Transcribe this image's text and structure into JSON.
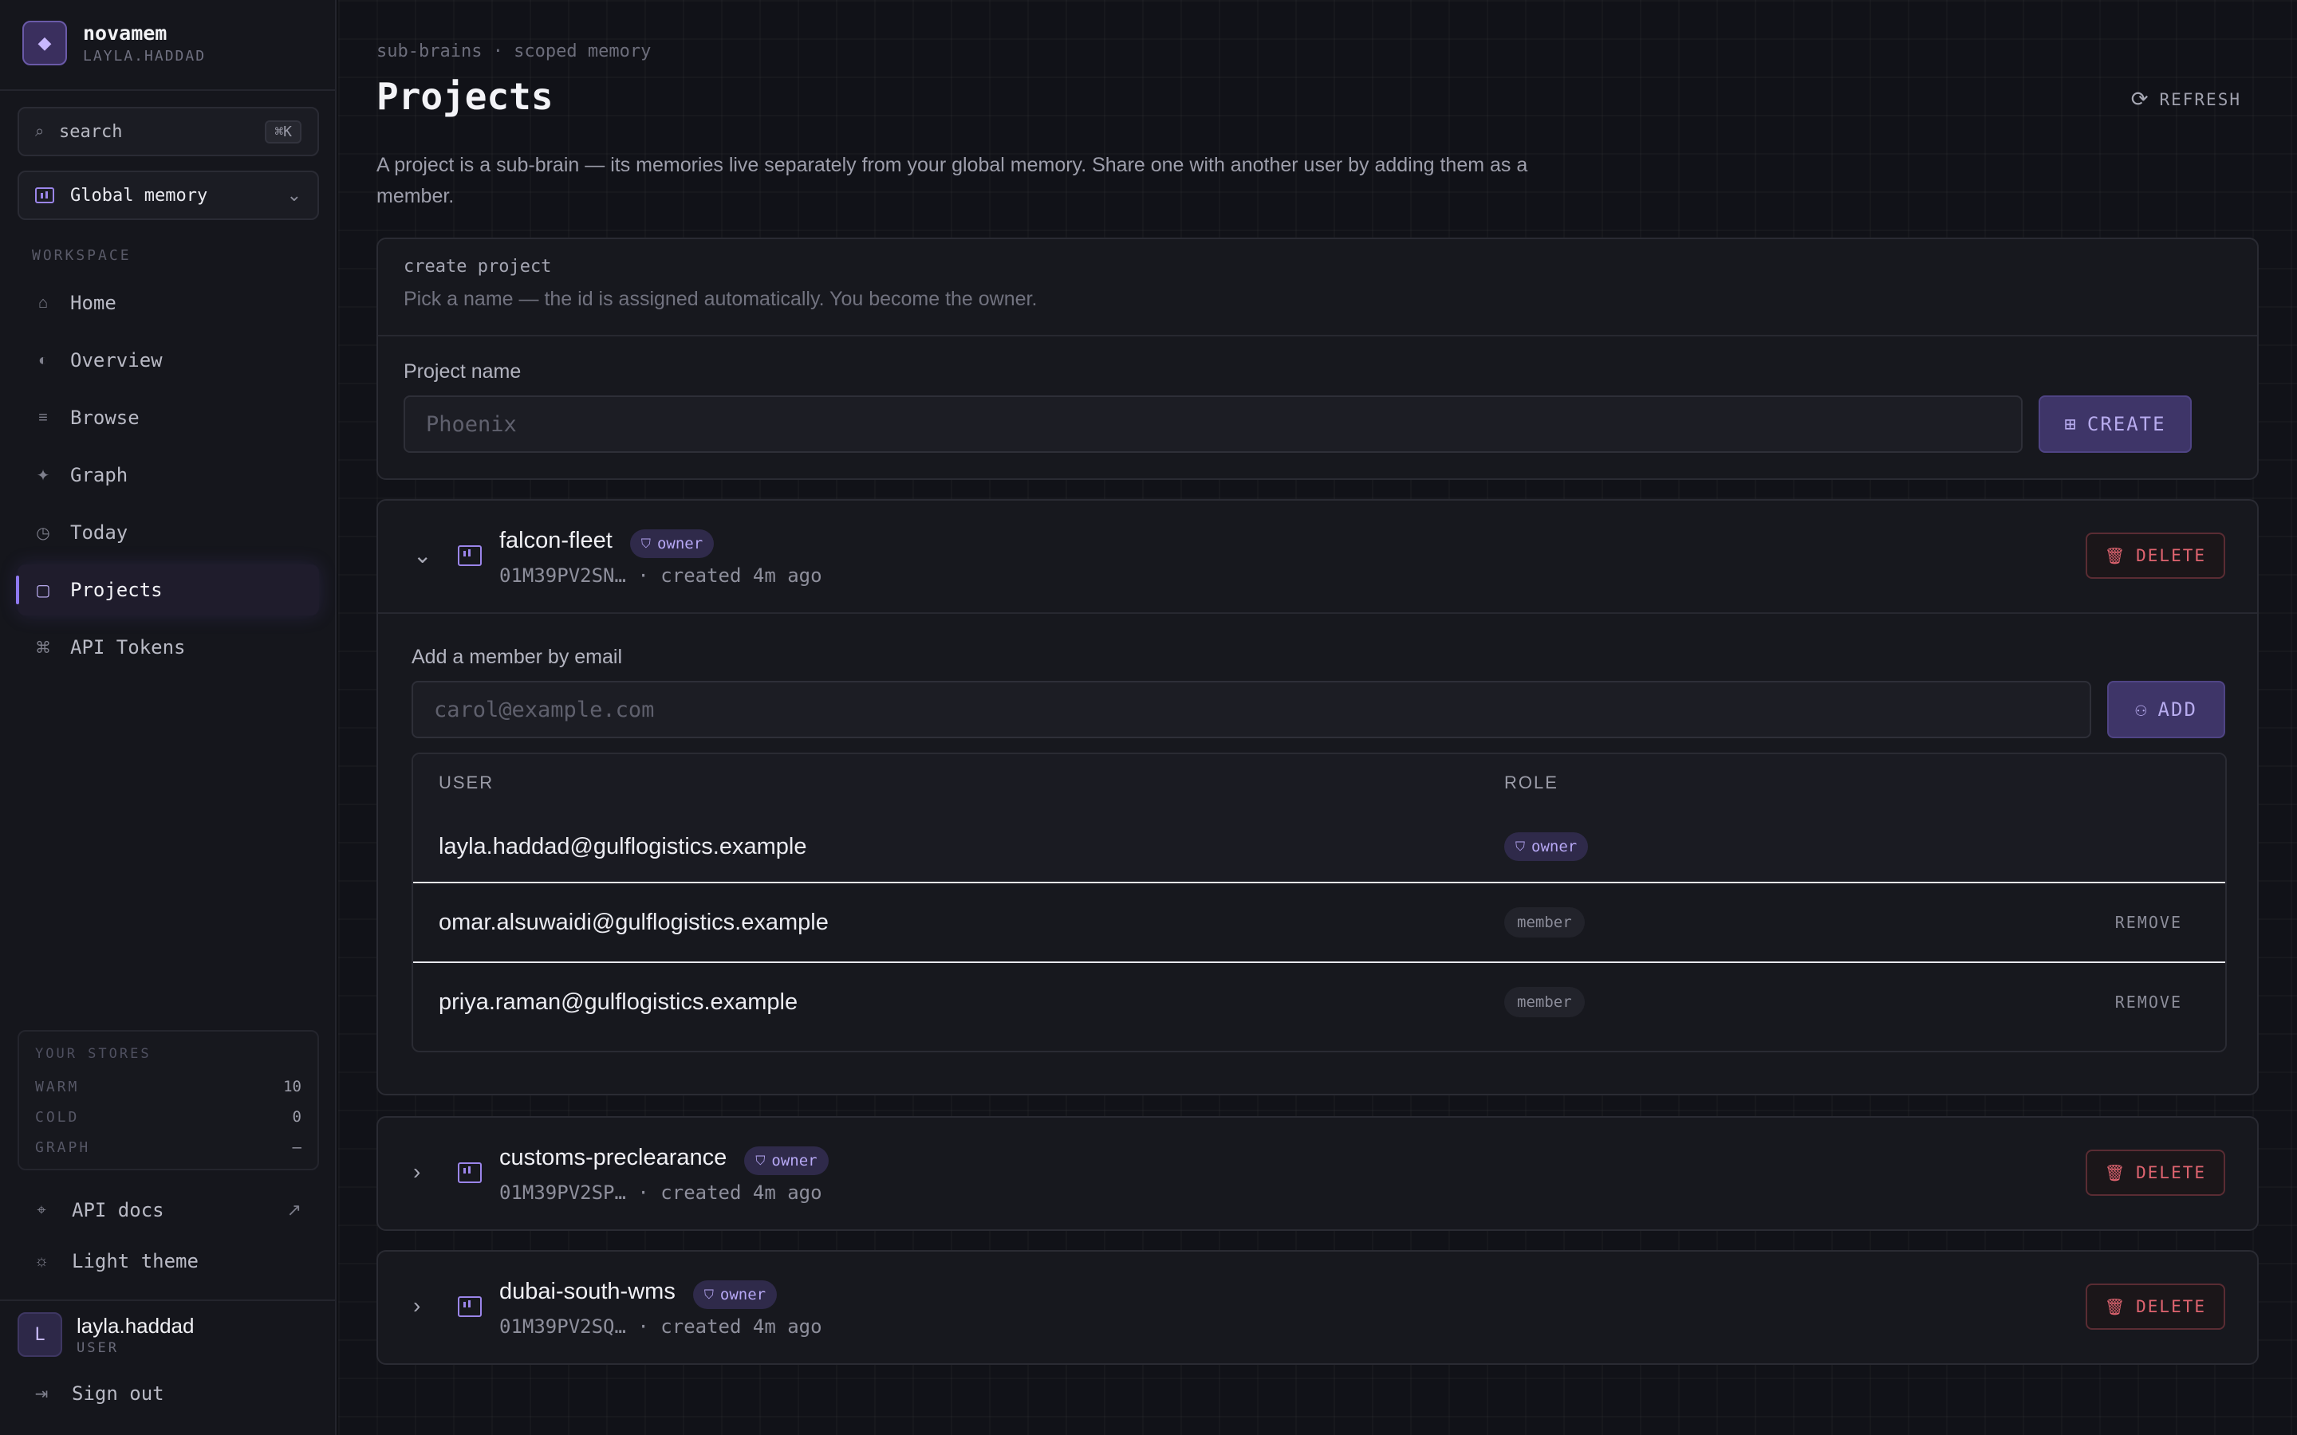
{
  "sidebar": {
    "brand": {
      "logo_glyph": "◆",
      "name": "novamem",
      "user": "LAYLA.HADDAD"
    },
    "search": {
      "placeholder": "search",
      "shortcut": "⌘K"
    },
    "scope": {
      "label": "Global memory"
    },
    "section_label": "WORKSPACE",
    "nav": [
      {
        "label": "Home",
        "icon": "⌂"
      },
      {
        "label": "Overview",
        "icon": "◐"
      },
      {
        "label": "Browse",
        "icon": "≡"
      },
      {
        "label": "Graph",
        "icon": "✦"
      },
      {
        "label": "Today",
        "icon": "◷"
      },
      {
        "label": "Projects",
        "icon": "▢"
      },
      {
        "label": "API Tokens",
        "icon": "⌘"
      }
    ],
    "stores": {
      "title": "YOUR STORES",
      "rows": [
        {
          "name": "WARM",
          "value": "10"
        },
        {
          "name": "COLD",
          "value": "0"
        },
        {
          "name": "GRAPH",
          "value": "—"
        }
      ]
    },
    "api_docs": "API docs",
    "theme_toggle": "Light theme",
    "user": {
      "initial": "L",
      "name": "layla.haddad",
      "role": "USER"
    },
    "sign_out": "Sign out"
  },
  "main": {
    "breadcrumb": "sub-brains · scoped memory",
    "title": "Projects",
    "refresh_label": "REFRESH",
    "intro": "A project is a sub-brain — its memories live separately from your global memory. Share one with another user by adding them as a member.",
    "create": {
      "title": "create project",
      "subtitle": "Pick a name — the id is assigned automatically. You become the owner.",
      "field_label": "Project name",
      "placeholder": "Phoenix",
      "button": "CREATE"
    },
    "projects": [
      {
        "name": "falcon-fleet",
        "badge": "owner",
        "meta": "01M39PV2SN… · created 4m ago",
        "delete": "DELETE",
        "add_member_label": "Add a member by email",
        "add_member_placeholder": "carol@example.com",
        "add_button": "ADD",
        "table": {
          "col_user": "USER",
          "col_role": "ROLE",
          "rows": [
            {
              "email": "layla.haddad@gulflogistics.example",
              "role": "owner"
            },
            {
              "email": "omar.alsuwaidi@gulflogistics.example",
              "role": "member",
              "action": "REMOVE"
            },
            {
              "email": "priya.raman@gulflogistics.example",
              "role": "member",
              "action": "REMOVE"
            }
          ]
        }
      },
      {
        "name": "customs-preclearance",
        "badge": "owner",
        "meta": "01M39PV2SP… · created 4m ago",
        "delete": "DELETE"
      },
      {
        "name": "dubai-south-wms",
        "badge": "owner",
        "meta": "01M39PV2SQ… · created 4m ago",
        "delete": "DELETE"
      }
    ]
  },
  "colors": {
    "accent": "#8f79f0",
    "danger": "#e06470",
    "background": "#111218",
    "sidebar": "#15161c"
  },
  "icons": {
    "brand": "diamond-icon",
    "search": "search-icon",
    "scope": "folder-chart-icon",
    "refresh": "refresh-icon",
    "expand": "chevron-icon",
    "delete": "trash-icon",
    "owner": "shield-icon",
    "external": "external-link-icon",
    "theme": "sun-icon",
    "signout": "sign-out-icon"
  }
}
